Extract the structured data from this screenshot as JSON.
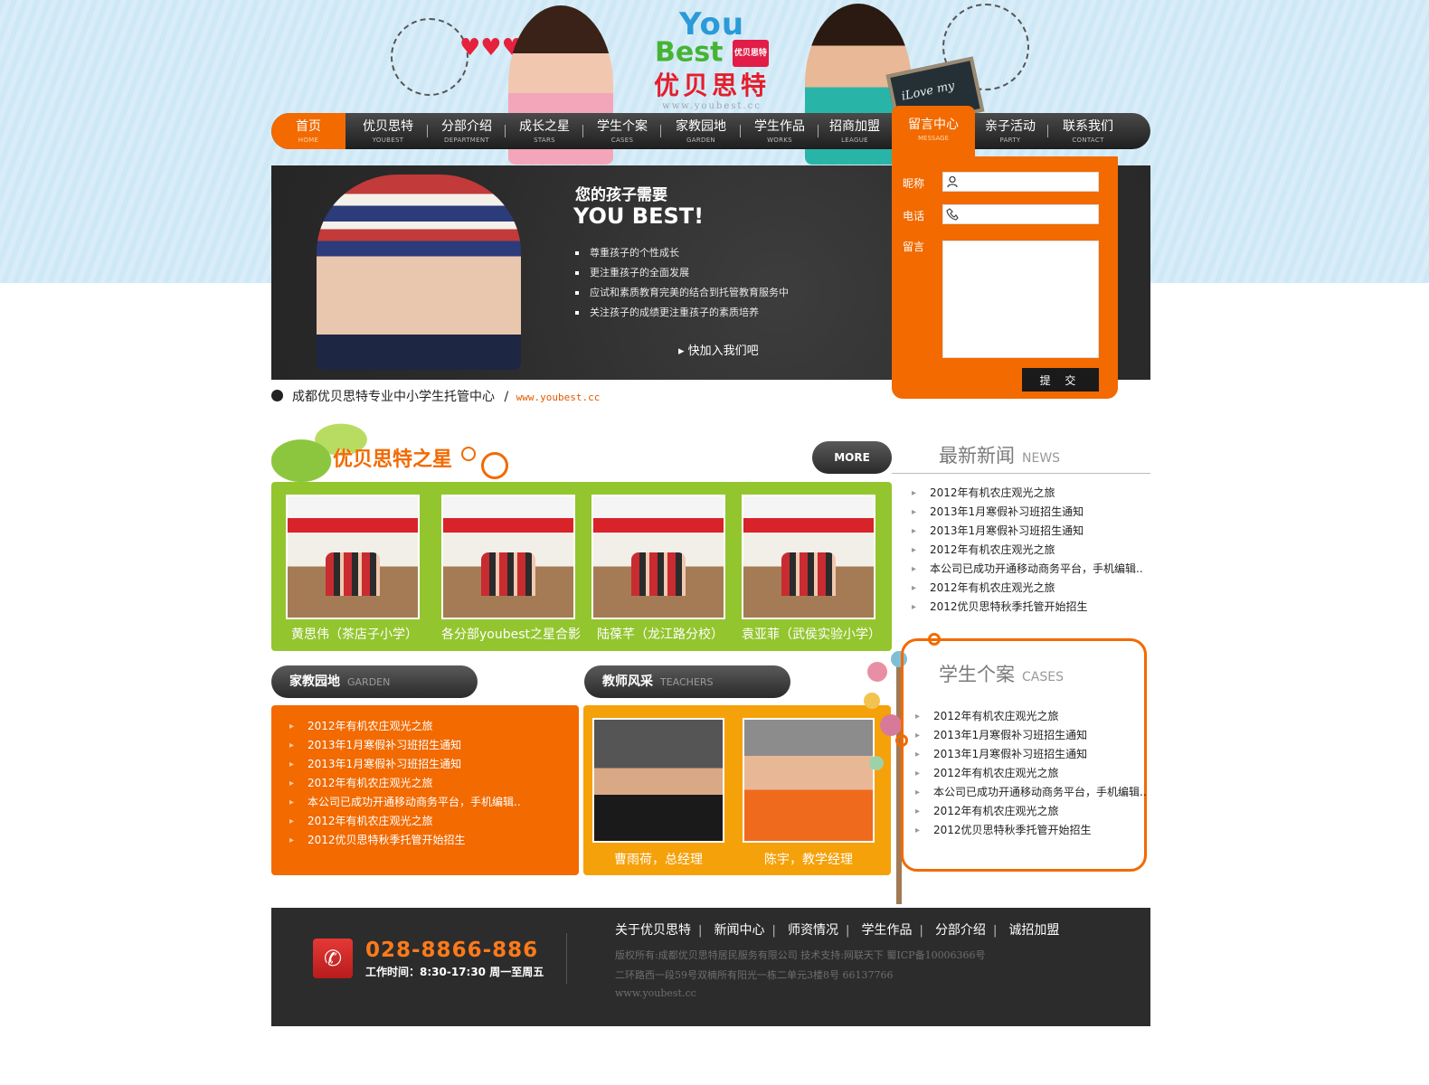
{
  "header": {
    "logo_you": "You",
    "logo_best": "Best",
    "logo_tag": "优贝思特",
    "logo_cn": "优贝思特",
    "logo_url": "www.youbest.cc",
    "chalkboard": "iLove my"
  },
  "nav": {
    "items": [
      {
        "cn": "首页",
        "en": "HOME"
      },
      {
        "cn": "优贝思特",
        "en": "YOUBEST"
      },
      {
        "cn": "分部介绍",
        "en": "DEPARTMENT"
      },
      {
        "cn": "成长之星",
        "en": "STARS"
      },
      {
        "cn": "学生个案",
        "en": "CASES"
      },
      {
        "cn": "家教园地",
        "en": "GARDEN"
      },
      {
        "cn": "学生作品",
        "en": "WORKS"
      },
      {
        "cn": "招商加盟",
        "en": "LEAGUE"
      },
      {
        "cn": "留言中心",
        "en": "MESSAGE"
      },
      {
        "cn": "亲子活动",
        "en": "PARTY"
      },
      {
        "cn": "联系我们",
        "en": "CONTACT"
      }
    ]
  },
  "banner": {
    "heading1": "您的孩子需要",
    "heading2": "YOU BEST!",
    "points": [
      "尊重孩子的个性成长",
      "更注重孩子的全面发展",
      "应试和素质教育完美的结合到托管教育服务中",
      "关注孩子的成绩更注重孩子的素质培养"
    ],
    "join": "快加入我们吧"
  },
  "message": {
    "nickname_label": "昵称",
    "phone_label": "电话",
    "message_label": "留言",
    "submit": "提 交"
  },
  "tagline": {
    "text": "成都优贝思特专业中小学生托管中心",
    "sep": "/",
    "url": "www.youbest.cc"
  },
  "stars": {
    "title": "优贝思特之星",
    "more": "MORE",
    "items": [
      {
        "caption": "黄思伟（茶店子小学）"
      },
      {
        "caption": "各分部youbest之星合影"
      },
      {
        "caption": "陆葆芊（龙江路分校）"
      },
      {
        "caption": "袁亚菲（武侯实验小学）"
      }
    ]
  },
  "news": {
    "title": "最新新闻",
    "title_en": "NEWS",
    "items": [
      "2012年有机农庄观光之旅",
      "2013年1月寒假补习班招生通知",
      "2013年1月寒假补习班招生通知",
      "2012年有机农庄观光之旅",
      "本公司已成功开通移动商务平台，手机编辑..",
      "2012年有机农庄观光之旅",
      "2012优贝思特秋季托管开始招生"
    ]
  },
  "garden": {
    "title": "家教园地",
    "title_en": "GARDEN",
    "items": [
      "2012年有机农庄观光之旅",
      "2013年1月寒假补习班招生通知",
      "2013年1月寒假补习班招生通知",
      "2012年有机农庄观光之旅",
      "本公司已成功开通移动商务平台，手机编辑..",
      "2012年有机农庄观光之旅",
      "2012优贝思特秋季托管开始招生"
    ]
  },
  "teachers": {
    "title": "教师风采",
    "title_en": "TEACHERS",
    "items": [
      {
        "caption": "曹雨荷，总经理"
      },
      {
        "caption": "陈宇，教学经理"
      }
    ]
  },
  "cases": {
    "title": "学生个案",
    "title_en": "CASES",
    "items": [
      "2012年有机农庄观光之旅",
      "2013年1月寒假补习班招生通知",
      "2013年1月寒假补习班招生通知",
      "2012年有机农庄观光之旅",
      "本公司已成功开通移动商务平台，手机编辑..",
      "2012年有机农庄观光之旅",
      "2012优贝思特秋季托管开始招生"
    ]
  },
  "footer": {
    "phone": "028-8866-886",
    "hours": "工作时间：8:30-17:30 周一至周五",
    "links": [
      "关于优贝思特",
      "新闻中心",
      "师资情况",
      "学生作品",
      "分部介绍",
      "诚招加盟"
    ],
    "copyright": "版权所有:成都优贝思特居民服务有限公司 技术支持:网联天下 蜀ICP备10006366号",
    "address": "二环路西一段59号双楠所有阳光一栋二单元3楼8号 66137766",
    "url": "www.youbest.cc"
  },
  "colors": {
    "accent": "#f26a00",
    "green": "#93c52f",
    "amber": "#f5a10a",
    "dark": "#2c2c2c",
    "sky": "#d3eaf7"
  },
  "icons": {
    "user": "user-icon",
    "phone_field": "phone-field-icon",
    "phone": "phone-icon",
    "bullet": "triangle-bullet-icon"
  }
}
